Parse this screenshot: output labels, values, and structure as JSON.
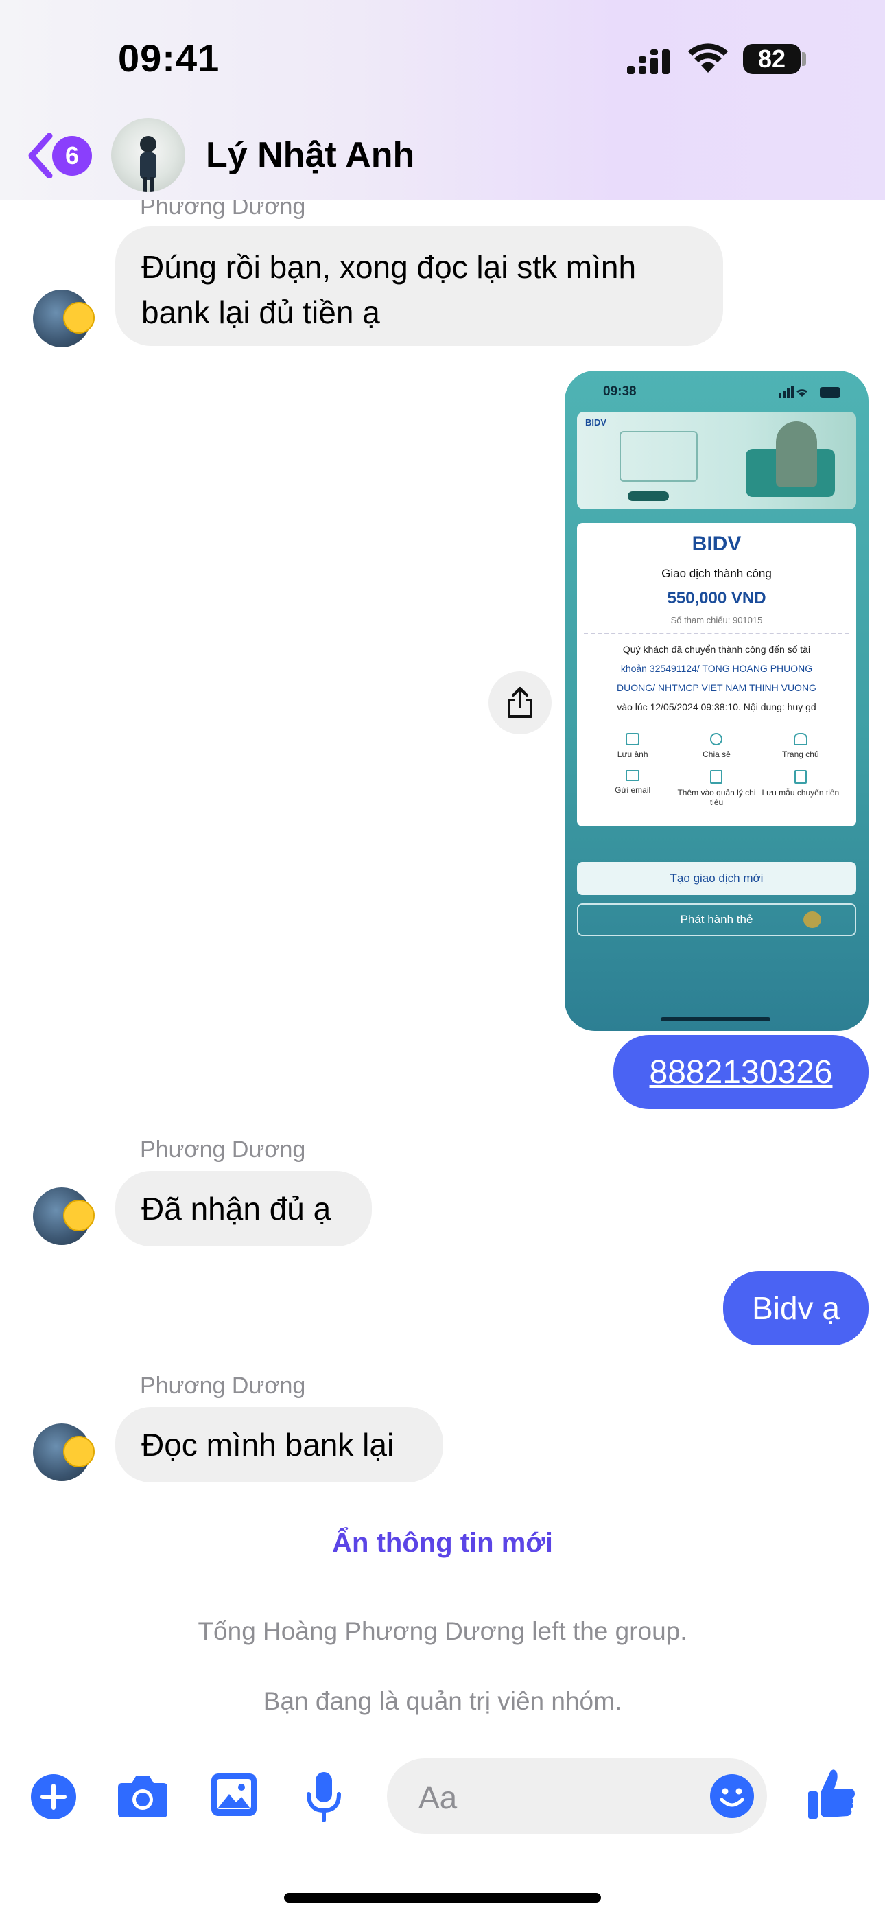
{
  "status_bar": {
    "time": "09:41",
    "battery": "82"
  },
  "header": {
    "back_badge": "6",
    "contact_name": "Lý Nhật Anh"
  },
  "messages": {
    "m1": {
      "sender": "Phương Dương",
      "line1": "Đúng rồi bạn, xong đọc lại stk mình",
      "line2": "bank lại đủ tiền ạ"
    },
    "m2_receipt": {
      "time": "09:38",
      "brand": "BIDV",
      "status": "Giao dịch thành công",
      "amount": "550,000 VND",
      "ref": "Số tham chiếu: 901015",
      "desc1": "Quý khách đã chuyển thành công đến số tài",
      "desc2": "khoản 325491124/ TONG HOANG PHUONG",
      "desc3": "DUONG/ NHTMCP VIET NAM THINH VUONG",
      "desc4": "vào lúc 12/05/2024 09:38:10. Nội dung: huy gd",
      "actions": [
        "Lưu ảnh",
        "Chia sẻ",
        "Trang chủ",
        "Gửi email",
        "Thêm vào quản lý chi tiêu",
        "Lưu mẫu chuyển tiền"
      ],
      "btn_new": "Tạo giao dịch mới",
      "btn_card": "Phát hành thẻ"
    },
    "m3": {
      "text": "8882130326"
    },
    "m4": {
      "sender": "Phương Dương",
      "text": "Đã nhận đủ ạ"
    },
    "m5": {
      "text": "Bidv ạ"
    },
    "m6": {
      "sender": "Phương Dương",
      "text": "Đọc mình bank lại"
    }
  },
  "hide_new": "Ẩn thông tin mới",
  "system": {
    "left_group": "Tống Hoàng Phương Dương left the group.",
    "admin": "Bạn đang là quản trị viên nhóm."
  },
  "composer": {
    "placeholder": "Aa"
  },
  "colors": {
    "accent": "#4a63f3",
    "badge": "#8a3ffc",
    "icon_blue": "#2f6bff"
  }
}
